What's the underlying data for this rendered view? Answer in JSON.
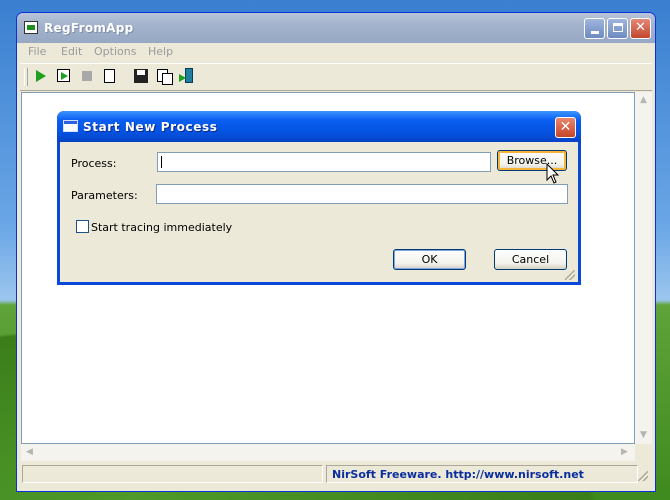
{
  "main_window": {
    "title": "RegFromApp",
    "menu": [
      "File",
      "Edit",
      "Options",
      "Help"
    ],
    "toolbar_icons": [
      "start-process-icon",
      "start-process-tracing-icon",
      "stop-icon",
      "new-icon",
      "save-icon",
      "copy-icon",
      "exit-icon"
    ],
    "status": {
      "left_text": "",
      "right_text": "NirSoft Freeware.  http://www.nirsoft.net"
    }
  },
  "dialog": {
    "title": "Start New Process",
    "process_label": "Process:",
    "process_value": "",
    "parameters_label": "Parameters:",
    "parameters_value": "",
    "browse_label": "Browse...",
    "checkbox_label": "Start tracing immediately",
    "checkbox_checked": false,
    "ok_label": "OK",
    "cancel_label": "Cancel"
  }
}
